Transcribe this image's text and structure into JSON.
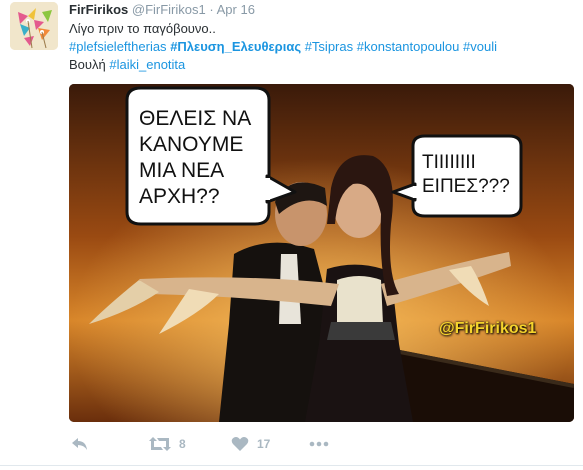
{
  "tweet": {
    "display_name": "FirFirikos",
    "username": "@FirFirikos1",
    "separator": "·",
    "timestamp": "Apr 16",
    "text_line1": "Λίγο πριν το παγόβουνο..",
    "hashtags_line2": [
      "#plefsieleftherias",
      "#Πλευση_Ελευθεριας",
      "#Tsipras",
      "#konstantopoulou",
      "#vouli"
    ],
    "text_line3_prefix": "Βουλή",
    "hashtag_line3": "#laiki_enotita"
  },
  "media": {
    "bubble_left": "ΘΕΛΕΙΣ ΝΑ ΚΑΝΟΥΜΕ ΜΙΑ ΝΕΑ ΑΡΧΗ??",
    "bubble_right": "ΤΙΙΙΙΙΙΙΙ ΕΙΠΕΣ???",
    "watermark": "@FirFirikos1"
  },
  "actions": {
    "retweet_count": "8",
    "like_count": "17"
  },
  "colors": {
    "link": "#1b95e0",
    "muted": "#8899a6",
    "action_icon": "#aab8c2",
    "watermark": "#f6d42c"
  },
  "icons": {
    "reply": "reply-icon",
    "retweet": "retweet-icon",
    "like": "heart-icon",
    "more": "more-dots-icon"
  }
}
